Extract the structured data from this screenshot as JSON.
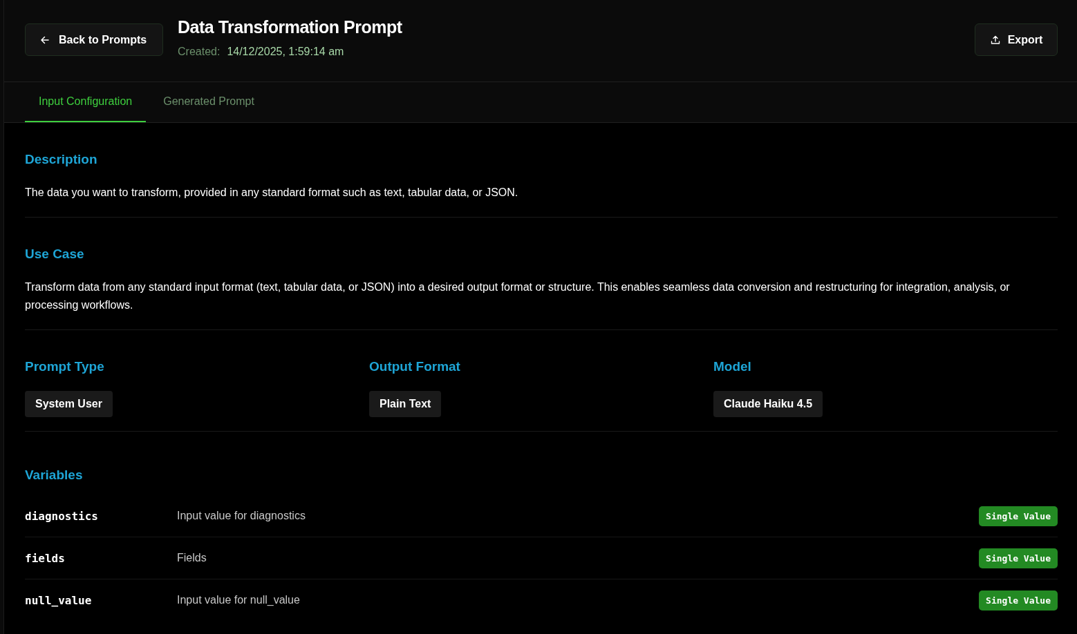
{
  "header": {
    "back_button": "Back to Prompts",
    "title": "Data Transformation Prompt",
    "created_label": "Created:",
    "created_value": "14/12/2025, 1:59:14 am",
    "export_button": "Export"
  },
  "tabs": [
    {
      "label": "Input Configuration",
      "selected": true
    },
    {
      "label": "Generated Prompt",
      "selected": false
    }
  ],
  "description": {
    "heading": "Description",
    "text": "The data you want to transform, provided in any standard format such as text, tabular data, or JSON."
  },
  "use_case": {
    "heading": "Use Case",
    "text": "Transform data from any standard input format (text, tabular data, or JSON) into a desired output format or structure. This enables seamless data conversion and restructuring for integration, analysis, or processing workflows."
  },
  "properties": [
    {
      "heading": "Prompt Type",
      "value": "System User"
    },
    {
      "heading": "Output Format",
      "value": "Plain Text"
    },
    {
      "heading": "Model",
      "value": "Claude Haiku 4.5"
    }
  ],
  "variables": {
    "heading": "Variables",
    "rows": [
      {
        "name": "diagnostics",
        "description": "Input value for diagnostics",
        "type": "Single Value"
      },
      {
        "name": "fields",
        "description": "Fields",
        "type": "Single Value"
      },
      {
        "name": "null_value",
        "description": "Input value for null_value",
        "type": "Single Value"
      }
    ]
  }
}
